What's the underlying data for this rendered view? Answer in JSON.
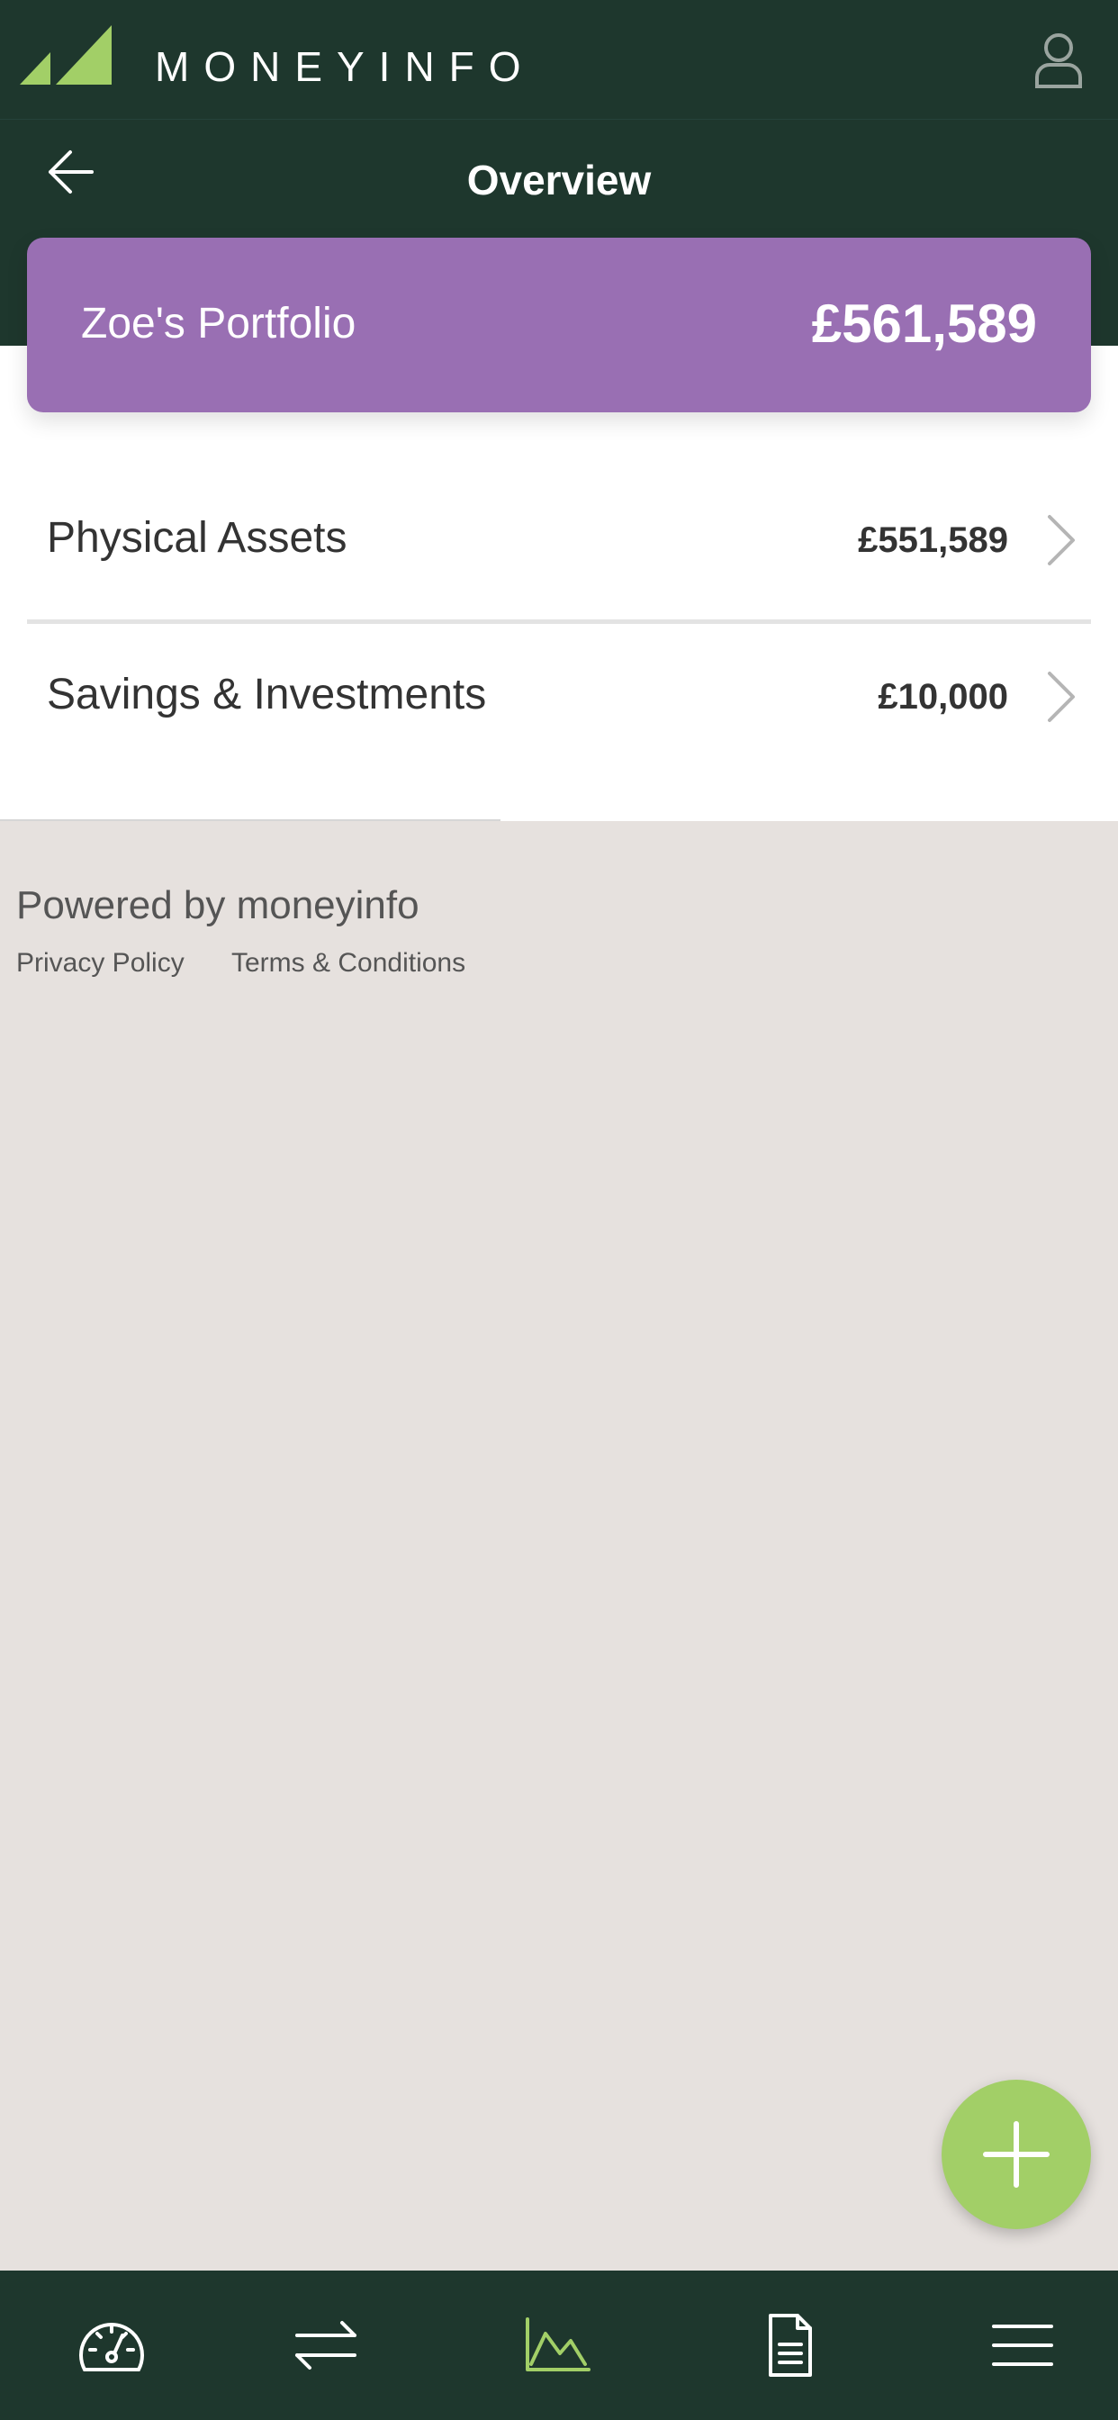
{
  "app": {
    "brand": "MONEYINFO",
    "colors": {
      "header": "#1e372d",
      "accent_green": "#a2cf67",
      "portfolio_purple": "#996fb3",
      "background": "#e6e1de"
    }
  },
  "header": {
    "title": "Overview",
    "back_icon": "arrow-left-icon",
    "profile_icon": "user-icon"
  },
  "portfolio": {
    "name": "Zoe's Portfolio",
    "total": "£561,589"
  },
  "categories": [
    {
      "label": "Physical Assets",
      "value": "£551,589"
    },
    {
      "label": "Savings & Investments",
      "value": "£10,000"
    }
  ],
  "footer": {
    "powered_by": "Powered by moneyinfo",
    "privacy": "Privacy Policy",
    "terms": "Terms & Conditions"
  },
  "fab": {
    "icon": "plus-icon"
  },
  "bottom_nav": {
    "items": [
      {
        "icon": "dashboard-gauge-icon",
        "active": false
      },
      {
        "icon": "transactions-arrows-icon",
        "active": false
      },
      {
        "icon": "chart-icon",
        "active": true
      },
      {
        "icon": "document-icon",
        "active": false
      },
      {
        "icon": "menu-icon",
        "active": false
      }
    ]
  }
}
